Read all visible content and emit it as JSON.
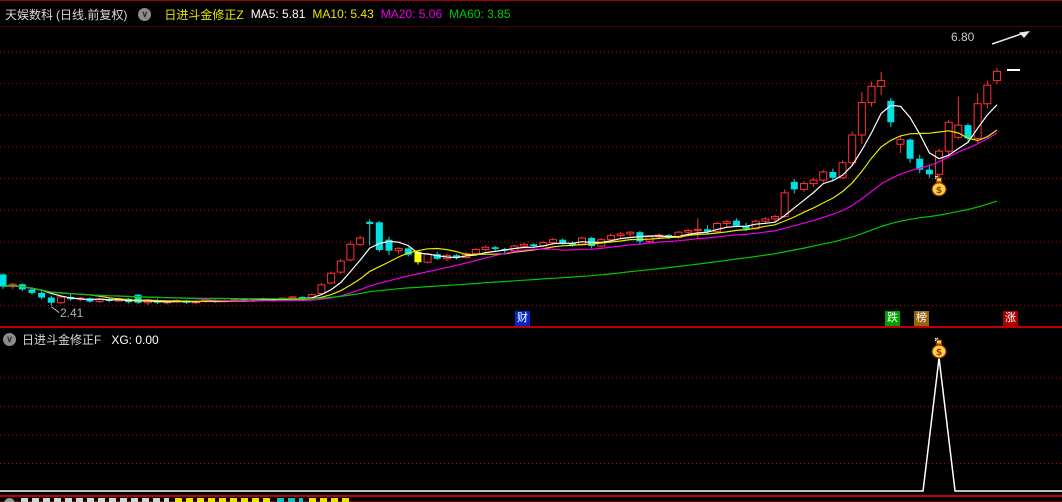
{
  "header": {
    "stock_name": "天娱数科",
    "period_label": "(日线.前复权)",
    "indicator_name": "日进斗金修正Z",
    "ma_values": [
      {
        "text": "MA5: 5.81",
        "color": "#ffffff"
      },
      {
        "text": "MA10: 5.43",
        "color": "#e8e800"
      },
      {
        "text": "MA20: 5.06",
        "color": "#e800e8"
      },
      {
        "text": "MA60: 3.85",
        "color": "#00c800"
      }
    ]
  },
  "main_chart": {
    "price_target_label": "6.80",
    "low_label": "2.41",
    "badges": [
      {
        "text": "财",
        "bg": "#0028c8"
      },
      {
        "text": "跌",
        "bg": "#00a000"
      },
      {
        "text": "榜",
        "bg": "#96640a"
      },
      {
        "text": "涨",
        "bg": "#aa0000"
      }
    ]
  },
  "panel2": {
    "indicator_name": "日进斗金修正F",
    "value_label": "XG: 0.00"
  },
  "colors": {
    "background": "#000000",
    "grid": "#c00000",
    "up_candle": "#ff3232",
    "down_candle": "#00e0e0",
    "signal_candle": "#ffff00",
    "ma5": "#ffffff",
    "ma10": "#e8e800",
    "ma20": "#e800e8",
    "ma60": "#00c800",
    "divider": "#c00000",
    "signal_line": "#ffffff",
    "money_bag": "#ffd040"
  },
  "chart_data": [
    {
      "type": "candlestick",
      "title": "天娱数科 日线 前复权",
      "legend": [
        "MA5: 5.81",
        "MA10: 5.43",
        "MA20: 5.06",
        "MA60: 3.85"
      ],
      "price_annotations": {
        "target_high": 6.8,
        "marked_low": 2.41,
        "last_close_dash": 6.48
      },
      "ylim": [
        2.3,
        6.95
      ],
      "grid": "horizontal-dotted-red",
      "moving_averages": [
        {
          "name": "MA5",
          "window": 5,
          "color": "#ffffff",
          "current": 5.81
        },
        {
          "name": "MA10",
          "window": 10,
          "color": "#e8e800",
          "current": 5.43
        },
        {
          "name": "MA20",
          "window": 20,
          "color": "#e800e8",
          "current": 5.06
        },
        {
          "name": "MA60",
          "window": 60,
          "color": "#00c800",
          "current": 3.85
        }
      ],
      "signal": {
        "money_bag_candle_index": 97,
        "yellow_candle_index": 43,
        "low_candle_index": 5
      },
      "candles_ohlc_flag": [
        [
          2.95,
          2.97,
          2.7,
          2.74,
          "d"
        ],
        [
          2.74,
          2.8,
          2.7,
          2.78,
          "u"
        ],
        [
          2.78,
          2.79,
          2.66,
          2.69,
          "d"
        ],
        [
          2.69,
          2.73,
          2.6,
          2.63,
          "d"
        ],
        [
          2.63,
          2.66,
          2.52,
          2.55,
          "d"
        ],
        [
          2.55,
          2.58,
          2.41,
          2.46,
          "d"
        ],
        [
          2.46,
          2.58,
          2.44,
          2.56,
          "u"
        ],
        [
          2.56,
          2.6,
          2.5,
          2.52,
          "d"
        ],
        [
          2.52,
          2.56,
          2.48,
          2.54,
          "u"
        ],
        [
          2.54,
          2.55,
          2.46,
          2.48,
          "d"
        ],
        [
          2.48,
          2.54,
          2.46,
          2.52,
          "u"
        ],
        [
          2.52,
          2.54,
          2.47,
          2.49,
          "d"
        ],
        [
          2.49,
          2.55,
          2.48,
          2.53,
          "u"
        ],
        [
          2.53,
          2.54,
          2.45,
          2.47,
          "d"
        ],
        [
          2.6,
          2.61,
          2.44,
          2.46,
          "d"
        ],
        [
          2.46,
          2.52,
          2.42,
          2.5,
          "u"
        ],
        [
          2.5,
          2.53,
          2.44,
          2.46,
          "d"
        ],
        [
          2.46,
          2.5,
          2.43,
          2.48,
          "u"
        ],
        [
          2.48,
          2.52,
          2.46,
          2.5,
          "u"
        ],
        [
          2.5,
          2.51,
          2.44,
          2.46,
          "d"
        ],
        [
          2.46,
          2.5,
          2.44,
          2.48,
          "u"
        ],
        [
          2.48,
          2.53,
          2.46,
          2.51,
          "u"
        ],
        [
          2.51,
          2.52,
          2.46,
          2.48,
          "d"
        ],
        [
          2.48,
          2.52,
          2.46,
          2.5,
          "u"
        ],
        [
          2.5,
          2.54,
          2.48,
          2.52,
          "u"
        ],
        [
          2.52,
          2.53,
          2.47,
          2.49,
          "d"
        ],
        [
          2.49,
          2.53,
          2.47,
          2.51,
          "u"
        ],
        [
          2.51,
          2.55,
          2.49,
          2.53,
          "u"
        ],
        [
          2.53,
          2.54,
          2.48,
          2.5,
          "d"
        ],
        [
          2.5,
          2.55,
          2.49,
          2.54,
          "u"
        ],
        [
          2.54,
          2.58,
          2.52,
          2.56,
          "u"
        ],
        [
          2.56,
          2.57,
          2.51,
          2.53,
          "d"
        ],
        [
          2.53,
          2.62,
          2.52,
          2.6,
          "u"
        ],
        [
          2.62,
          2.8,
          2.6,
          2.77,
          "u"
        ],
        [
          2.8,
          3.0,
          2.78,
          2.97,
          "u"
        ],
        [
          2.99,
          3.22,
          2.96,
          3.18,
          "u"
        ],
        [
          3.2,
          3.52,
          3.17,
          3.47,
          "u"
        ],
        [
          3.47,
          3.62,
          3.44,
          3.58,
          "u"
        ],
        [
          3.86,
          3.9,
          3.45,
          3.82,
          "d"
        ],
        [
          3.85,
          3.87,
          3.34,
          3.37,
          "d"
        ],
        [
          3.55,
          3.6,
          3.28,
          3.36,
          "d"
        ],
        [
          3.36,
          3.42,
          3.3,
          3.4,
          "u"
        ],
        [
          3.4,
          3.42,
          3.26,
          3.29,
          "d"
        ],
        [
          3.34,
          3.36,
          3.12,
          3.16,
          "y"
        ],
        [
          3.16,
          3.32,
          3.14,
          3.3,
          "u"
        ],
        [
          3.3,
          3.34,
          3.2,
          3.22,
          "d"
        ],
        [
          3.22,
          3.3,
          3.18,
          3.28,
          "u"
        ],
        [
          3.28,
          3.3,
          3.21,
          3.24,
          "d"
        ],
        [
          3.24,
          3.34,
          3.22,
          3.31,
          "u"
        ],
        [
          3.31,
          3.4,
          3.28,
          3.38,
          "u"
        ],
        [
          3.38,
          3.45,
          3.35,
          3.42,
          "u"
        ],
        [
          3.42,
          3.44,
          3.36,
          3.39,
          "d"
        ],
        [
          3.39,
          3.41,
          3.32,
          3.36,
          "d"
        ],
        [
          3.36,
          3.46,
          3.34,
          3.44,
          "u"
        ],
        [
          3.44,
          3.5,
          3.4,
          3.47,
          "u"
        ],
        [
          3.47,
          3.49,
          3.41,
          3.44,
          "d"
        ],
        [
          3.44,
          3.52,
          3.42,
          3.5,
          "u"
        ],
        [
          3.5,
          3.58,
          3.46,
          3.55,
          "u"
        ],
        [
          3.55,
          3.57,
          3.46,
          3.49,
          "d"
        ],
        [
          3.49,
          3.52,
          3.43,
          3.46,
          "d"
        ],
        [
          3.46,
          3.6,
          3.44,
          3.58,
          "u"
        ],
        [
          3.58,
          3.6,
          3.4,
          3.44,
          "d"
        ],
        [
          3.44,
          3.58,
          3.42,
          3.55,
          "u"
        ],
        [
          3.55,
          3.66,
          3.52,
          3.62,
          "u"
        ],
        [
          3.62,
          3.68,
          3.56,
          3.65,
          "u"
        ],
        [
          3.65,
          3.7,
          3.6,
          3.68,
          "u"
        ],
        [
          3.68,
          3.7,
          3.48,
          3.52,
          "d"
        ],
        [
          3.52,
          3.62,
          3.5,
          3.6,
          "u"
        ],
        [
          3.6,
          3.66,
          3.56,
          3.63,
          "u"
        ],
        [
          3.63,
          3.65,
          3.56,
          3.59,
          "d"
        ],
        [
          3.59,
          3.7,
          3.57,
          3.68,
          "u"
        ],
        [
          3.68,
          3.74,
          3.62,
          3.71,
          "u"
        ],
        [
          3.71,
          3.92,
          3.58,
          3.73,
          "u"
        ],
        [
          3.73,
          3.8,
          3.66,
          3.69,
          "d"
        ],
        [
          3.69,
          3.86,
          3.67,
          3.83,
          "u"
        ],
        [
          3.83,
          3.89,
          3.76,
          3.86,
          "u"
        ],
        [
          3.88,
          3.92,
          3.76,
          3.79,
          "d"
        ],
        [
          3.79,
          3.84,
          3.7,
          3.74,
          "d"
        ],
        [
          3.74,
          3.9,
          3.72,
          3.87,
          "u"
        ],
        [
          3.87,
          3.94,
          3.82,
          3.91,
          "u"
        ],
        [
          3.91,
          3.98,
          3.86,
          3.95,
          "u"
        ],
        [
          3.95,
          4.42,
          3.93,
          4.36,
          "u"
        ],
        [
          4.55,
          4.6,
          4.35,
          4.42,
          "d"
        ],
        [
          4.42,
          4.56,
          4.38,
          4.52,
          "u"
        ],
        [
          4.52,
          4.62,
          4.46,
          4.58,
          "u"
        ],
        [
          4.58,
          4.76,
          4.54,
          4.72,
          "u"
        ],
        [
          4.72,
          4.78,
          4.58,
          4.62,
          "d"
        ],
        [
          4.62,
          4.92,
          4.6,
          4.88,
          "u"
        ],
        [
          4.88,
          5.42,
          4.84,
          5.36,
          "u"
        ],
        [
          5.36,
          6.1,
          5.2,
          5.92,
          "u"
        ],
        [
          5.92,
          6.28,
          5.85,
          6.2,
          "u"
        ],
        [
          6.2,
          6.45,
          6.05,
          6.3,
          "u"
        ],
        [
          5.95,
          6.0,
          5.5,
          5.58,
          "d"
        ],
        [
          5.2,
          5.35,
          5.05,
          5.28,
          "u"
        ],
        [
          5.28,
          5.3,
          4.88,
          4.95,
          "d"
        ],
        [
          4.95,
          5.02,
          4.7,
          4.76,
          "d"
        ],
        [
          4.76,
          4.85,
          4.62,
          4.68,
          "d"
        ],
        [
          4.68,
          5.12,
          4.62,
          5.08,
          "u"
        ],
        [
          5.08,
          5.62,
          5.02,
          5.58,
          "u"
        ],
        [
          5.32,
          6.02,
          5.28,
          5.53,
          "u"
        ],
        [
          5.53,
          5.56,
          5.25,
          5.3,
          "d"
        ],
        [
          5.3,
          6.08,
          5.22,
          5.9,
          "u"
        ],
        [
          5.9,
          6.3,
          5.82,
          6.22,
          "u"
        ],
        [
          6.3,
          6.52,
          6.24,
          6.46,
          "u"
        ]
      ]
    },
    {
      "type": "line",
      "title": "日进斗金修正F",
      "current_value_label": "XG: 0.00",
      "baseline_value": 0,
      "spike": {
        "candle_index": 97,
        "value": 1,
        "icon": "money-bag"
      },
      "grid": "horizontal-dotted-red",
      "line_color": "#ffffff"
    }
  ]
}
